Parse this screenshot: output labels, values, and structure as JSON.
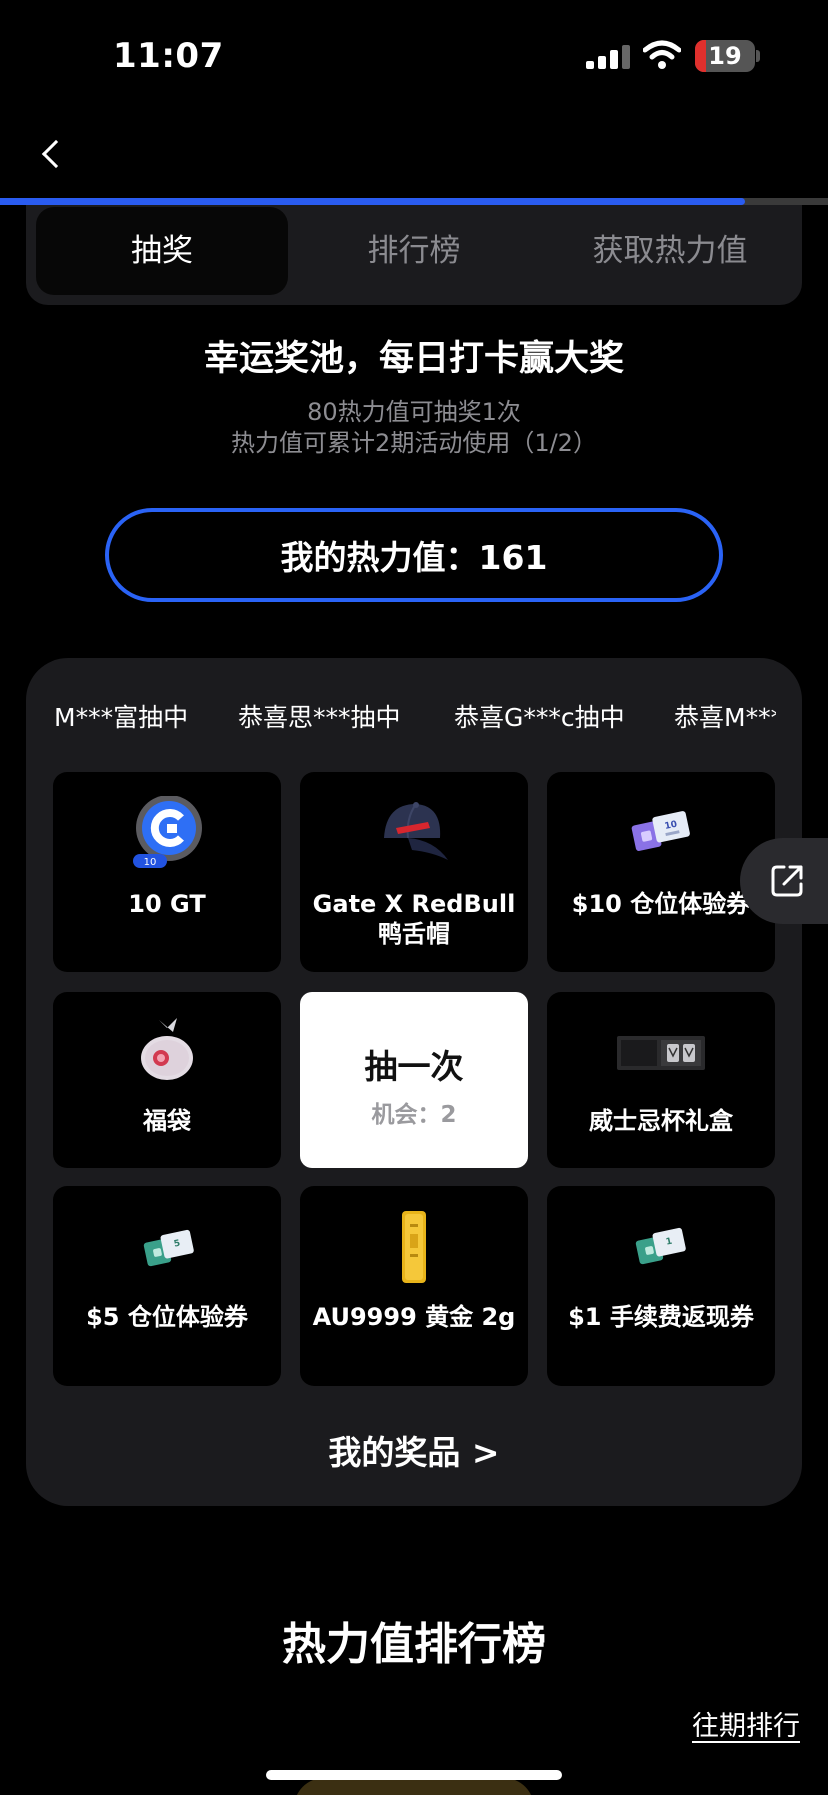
{
  "status_bar": {
    "time": "11:07",
    "battery": "19",
    "battery_level": 0.19
  },
  "page_progress": 0.9,
  "tabs": [
    {
      "label": "抽奖",
      "active": true
    },
    {
      "label": "排行榜",
      "active": false
    },
    {
      "label": "获取热力值",
      "active": false
    }
  ],
  "intro": {
    "title": "幸运奖池，每日打卡赢大奖",
    "line1": "80热力值可抽奖1次",
    "line2": "热力值可累计2期活动使用（1/2）"
  },
  "heat": {
    "text": "我的热力值：161"
  },
  "ticker": [
    "M***富抽中",
    "恭喜思***抽中",
    "恭喜G***c抽中",
    "恭喜M***"
  ],
  "prizes": [
    {
      "label": "10 GT",
      "icon": "gt-coin-icon",
      "badge": "10"
    },
    {
      "label": "Gate X RedBull 鸭舌帽",
      "icon": "cap-icon"
    },
    {
      "label": "$10 仓位体验券",
      "icon": "voucher-icon",
      "badge": "10"
    },
    {
      "label": "福袋",
      "icon": "lucky-bag-icon"
    },
    {
      "label": "威士忌杯礼盒",
      "icon": "whisky-box-icon"
    },
    {
      "label": "$5 仓位体验券",
      "icon": "voucher-icon",
      "badge": "5"
    },
    {
      "label": "AU9999 黄金 2g",
      "icon": "gold-bar-icon"
    },
    {
      "label": "$1 手续费返现券",
      "icon": "voucher-icon",
      "badge": "1"
    }
  ],
  "draw": {
    "title": "抽一次",
    "chances": "机会：2"
  },
  "my_prizes": "我的奖品 >",
  "ranking": {
    "title": "热力值排行榜",
    "past": "往期排行"
  },
  "colors": {
    "accent": "#2a63f6",
    "panel": "#1b1b1e",
    "battery": "#e0302d"
  }
}
